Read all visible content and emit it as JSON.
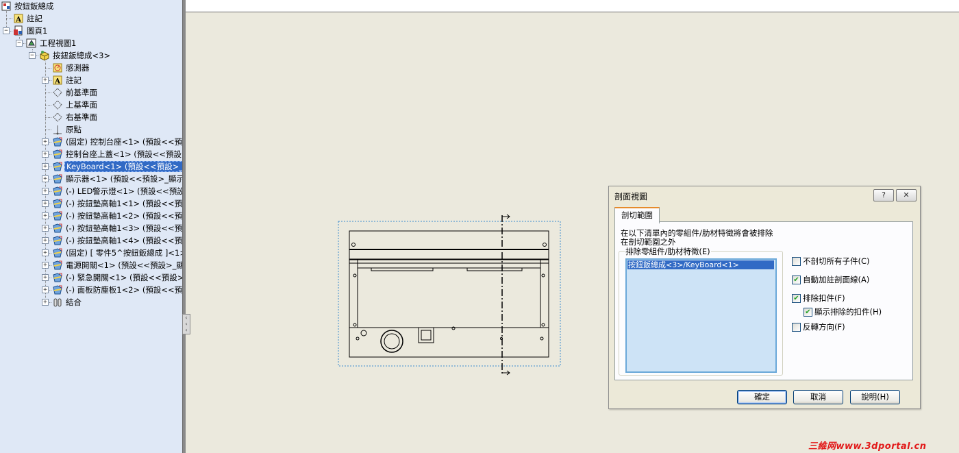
{
  "tree": {
    "root_label": "按鈕鈑總成",
    "nodes": [
      {
        "label": "註記",
        "icon": "annotation-icon",
        "expand": ""
      },
      {
        "label": "圖頁1",
        "icon": "sheet-icon",
        "expand": "−"
      },
      {
        "label": "工程視圖1",
        "icon": "drawing-view-icon",
        "expand": "−"
      },
      {
        "label": "按鈕鈑總成<3>",
        "icon": "assembly-icon",
        "expand": "−"
      },
      {
        "label": "感測器",
        "icon": "sensor-icon",
        "expand": ""
      },
      {
        "label": "註記",
        "icon": "annotation-icon",
        "expand": "+"
      },
      {
        "label": "前基準面",
        "icon": "plane-icon",
        "expand": ""
      },
      {
        "label": "上基準面",
        "icon": "plane-icon",
        "expand": ""
      },
      {
        "label": "右基準面",
        "icon": "plane-icon",
        "expand": ""
      },
      {
        "label": "原點",
        "icon": "origin-icon",
        "expand": ""
      },
      {
        "label": "(固定) 控制台座<1> (預設<<預",
        "icon": "part-icon",
        "expand": "+"
      },
      {
        "label": "控制台座上蓋<1> (預設<<預設",
        "icon": "part-icon",
        "expand": "+"
      },
      {
        "label": "KeyBoard<1> (預設<<預設>_顯",
        "icon": "part-icon",
        "expand": "+"
      },
      {
        "label": "顯示器<1> (預設<<預設>_顯示",
        "icon": "part-icon",
        "expand": "+"
      },
      {
        "label": "(-) LED警示燈<1> (預設<<預設",
        "icon": "part-icon",
        "expand": "+"
      },
      {
        "label": "(-) 按鈕墊高軸1<1> (預設<<預",
        "icon": "part-icon",
        "expand": "+"
      },
      {
        "label": "(-) 按鈕墊高軸1<2> (預設<<預",
        "icon": "part-icon",
        "expand": "+"
      },
      {
        "label": "(-) 按鈕墊高軸1<3> (預設<<預",
        "icon": "part-icon",
        "expand": "+"
      },
      {
        "label": "(-) 按鈕墊高軸1<4> (預設<<預",
        "icon": "part-icon",
        "expand": "+"
      },
      {
        "label": "(固定) [ 零件5^按鈕鈑總成 ]<1>",
        "icon": "part-icon",
        "expand": "+"
      },
      {
        "label": "電源開關<1> (預設<<預設>_顯",
        "icon": "part-icon",
        "expand": "+"
      },
      {
        "label": "(-) 緊急開關<1> (預設<<預設>",
        "icon": "part-icon",
        "expand": "+"
      },
      {
        "label": "(-) 面板防塵板1<2> (預設<<預",
        "icon": "part-icon",
        "expand": "+"
      },
      {
        "label": "結合",
        "icon": "mates-icon",
        "expand": "+"
      }
    ]
  },
  "dialog": {
    "title": "剖面視圖",
    "help_button": "?",
    "close_button": "✕",
    "tab_label": "剖切範圍",
    "description_line1": "在以下清單內的零組件/肋材特徵將會被排除",
    "description_line2": "在剖切範圍之外",
    "group_label": "排除零組件/肋材特徵(E)",
    "list_items": [
      "按鈕鈑總成<3>/KeyBoard<1>"
    ],
    "options": [
      {
        "label": "不剖切所有子件(C)",
        "checked": false
      },
      {
        "label": "自動加註剖面線(A)",
        "checked": true
      },
      {
        "label": "排除扣件(F)",
        "checked": true
      },
      {
        "label": "顯示排除的扣件(H)",
        "checked": true
      },
      {
        "label": "反轉方向(F)",
        "checked": false
      }
    ],
    "ok_label": "確定",
    "cancel_label": "取消",
    "help_label": "說明(H)"
  },
  "watermark": "三維网www.3dportal.cn",
  "colors": {
    "canvas": "#ebe9dd",
    "tree_bg": "#dfe8f6",
    "selection": "#316ac5",
    "watermark": "#e21a1a"
  }
}
